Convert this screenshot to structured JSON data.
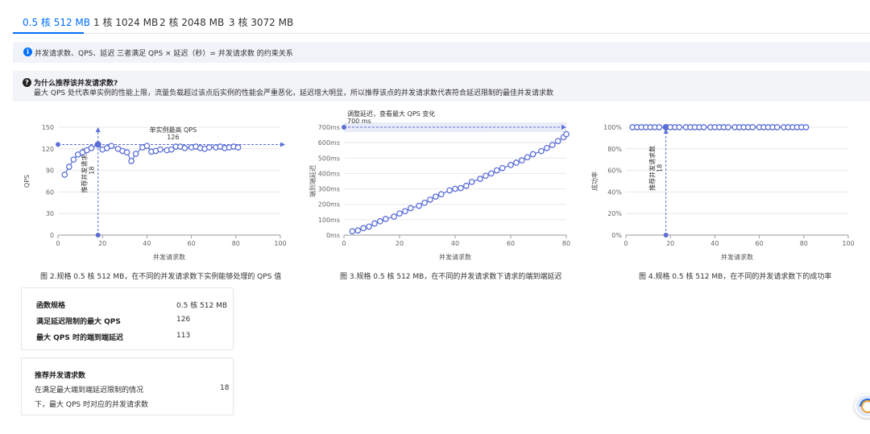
{
  "tabs": [
    {
      "label": "0.5 核 512 MB",
      "active": true
    },
    {
      "label": "1 核 1024 MB",
      "active": false
    },
    {
      "label": "2 核 2048 MB",
      "active": false
    },
    {
      "label": "3 核 3072 MB",
      "active": false
    }
  ],
  "info_bar": {
    "icon": "info-icon",
    "text": "并发请求数、QPS、延迟 三者满足 QPS × 延迟（秒）= 并发请求数 的约束关系"
  },
  "qa": {
    "icon": "question-icon",
    "title": "为什么推荐该并发请求数?",
    "desc": "最大 QPS 处代表单实例的性能上限，流量负载超过该点后实例的性能会严重恶化，延迟增大明显，所以推荐该点的并发请求数代表符合延迟限制的最佳并发请求数"
  },
  "colors": {
    "accent": "#006eff",
    "series": "#5b6fd6",
    "grid": "#e8e8e8"
  },
  "chart_data": [
    {
      "type": "line",
      "title": "",
      "xlabel": "并发请求数",
      "ylabel": "QPS",
      "xlim": [
        0,
        100
      ],
      "ylim": [
        0,
        150
      ],
      "x_ticks": [
        0,
        20,
        40,
        60,
        80,
        100
      ],
      "y_ticks": [
        0,
        30,
        60,
        90,
        120,
        150
      ],
      "x_tick_labels": [
        "0",
        "20",
        "40",
        "60",
        "80",
        "100"
      ],
      "y_tick_labels": [
        "0",
        "30",
        "60",
        "90",
        "120",
        "150"
      ],
      "x": [
        3,
        5,
        7,
        9,
        11,
        13,
        15,
        18,
        20,
        22,
        24,
        27,
        29,
        31,
        33,
        35,
        38,
        40,
        42,
        44,
        46,
        49,
        51,
        53,
        55,
        57,
        60,
        62,
        64,
        66,
        68,
        71,
        73,
        75,
        77,
        79,
        81
      ],
      "values": [
        84,
        95,
        105,
        112,
        115,
        118,
        121,
        126,
        119,
        121,
        124,
        120,
        117,
        115,
        103,
        113,
        122,
        124,
        116,
        117,
        119,
        118,
        119,
        123,
        123,
        121,
        122,
        123,
        121,
        120,
        122,
        122,
        123,
        121,
        122,
        123,
        122
      ],
      "annotations": {
        "peak_label": "单实例最高 QPS",
        "peak_value": "126",
        "rec_label": "推荐并发请求数",
        "rec_value": "18"
      },
      "peak_x": 18,
      "peak_y": 126,
      "caption": "图 2.规格 0.5 核 512 MB，在不同的并发请求数下实例能够处理的 QPS 值"
    },
    {
      "type": "line",
      "title": "",
      "xlabel": "并发请求数",
      "ylabel": "端到端延迟",
      "xlim": [
        0,
        80
      ],
      "ylim": [
        0,
        700
      ],
      "x_ticks": [
        0,
        20,
        40,
        60,
        80
      ],
      "y_ticks": [
        0,
        100,
        200,
        300,
        400,
        500,
        600,
        700
      ],
      "x_tick_labels": [
        "0",
        "20",
        "40",
        "60",
        "80"
      ],
      "y_tick_labels": [
        "0ms",
        "100ms",
        "200ms",
        "300ms",
        "400ms",
        "500ms",
        "600ms",
        "700ms"
      ],
      "x": [
        3,
        5,
        7,
        9,
        11,
        13,
        15,
        18,
        20,
        22,
        24,
        27,
        29,
        31,
        33,
        35,
        38,
        40,
        42,
        44,
        46,
        49,
        51,
        53,
        55,
        57,
        60,
        62,
        64,
        66,
        68,
        71,
        73,
        75,
        77,
        79,
        81
      ],
      "values": [
        25,
        30,
        45,
        55,
        75,
        90,
        105,
        120,
        140,
        155,
        175,
        190,
        210,
        230,
        250,
        265,
        290,
        300,
        305,
        320,
        345,
        365,
        385,
        400,
        420,
        435,
        455,
        470,
        485,
        505,
        525,
        545,
        565,
        585,
        610,
        635,
        655
      ],
      "annotations": {
        "limit_label": "调整延迟，查看最大 QPS 变化",
        "limit_value": "700 ms"
      },
      "limit_y": 700,
      "caption": "图 3.规格 0.5 核 512 MB，在不同的并发请求数下请求的端到端延迟"
    },
    {
      "type": "line",
      "title": "",
      "xlabel": "并发请求数",
      "ylabel": "成功率",
      "xlim": [
        0,
        100
      ],
      "ylim": [
        0,
        100
      ],
      "x_ticks": [
        0,
        20,
        40,
        60,
        80,
        100
      ],
      "y_ticks": [
        0,
        20,
        40,
        60,
        80,
        100
      ],
      "x_tick_labels": [
        "0",
        "20",
        "40",
        "60",
        "80",
        "100"
      ],
      "y_tick_labels": [
        "0%",
        "20%",
        "40%",
        "60%",
        "80%",
        "100%"
      ],
      "x": [
        3,
        5,
        7,
        9,
        11,
        13,
        15,
        18,
        20,
        22,
        24,
        27,
        29,
        31,
        33,
        35,
        38,
        40,
        42,
        44,
        46,
        49,
        51,
        53,
        55,
        57,
        60,
        62,
        64,
        66,
        68,
        71,
        73,
        75,
        77,
        79,
        81
      ],
      "values": [
        100,
        100,
        100,
        100,
        100,
        100,
        100,
        100,
        100,
        100,
        100,
        100,
        100,
        100,
        100,
        100,
        100,
        100,
        100,
        100,
        100,
        100,
        100,
        100,
        100,
        100,
        100,
        100,
        100,
        100,
        100,
        100,
        100,
        100,
        100,
        100,
        100
      ],
      "annotations": {
        "rec_label": "推荐并发请求数",
        "rec_value": "18"
      },
      "rec_x": 18,
      "caption": "图 4.规格 0.5 核 512 MB，在不同的并发请求数下的成功率"
    }
  ],
  "summary": {
    "rows": [
      {
        "key": "函数规格",
        "value": "0.5 核 512 MB"
      },
      {
        "key": "满足延迟限制的最大 QPS",
        "value": "126"
      },
      {
        "key": "最大 QPS 时的端到端延迟",
        "value": "113"
      }
    ]
  },
  "recommend": {
    "title": "推荐并发请求数",
    "line1": "在满足最大端到端延迟限制的情况",
    "line2": "下，最大 QPS 时对应的并发请求数",
    "value": "18"
  },
  "assistant": {
    "icon": "assistant-avatar-icon"
  }
}
